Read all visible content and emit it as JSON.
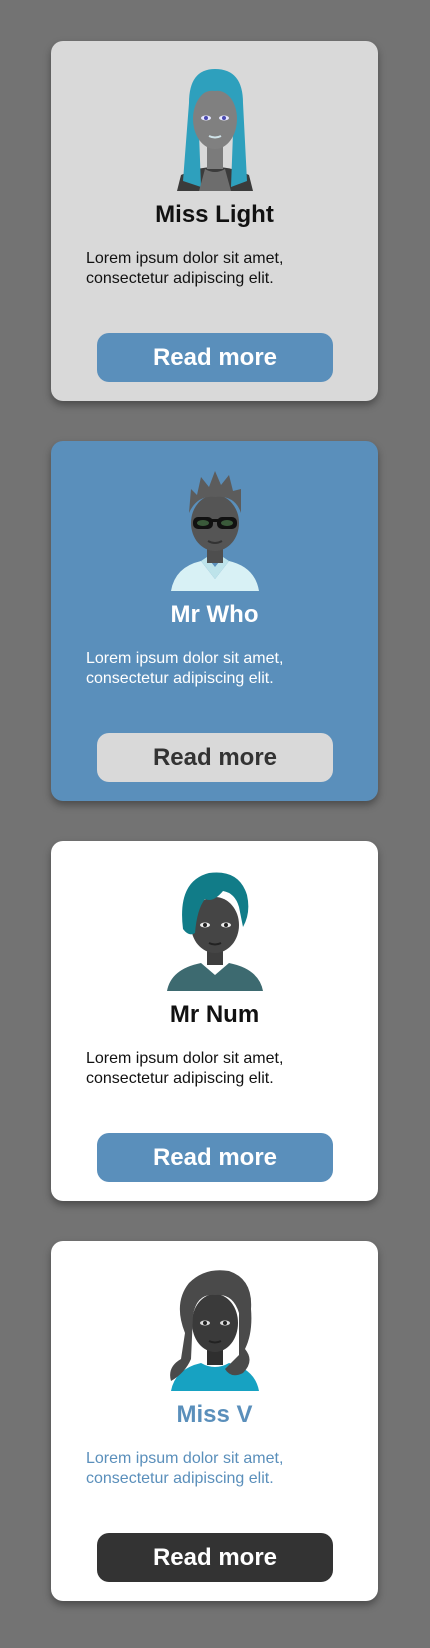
{
  "cards": [
    {
      "name": "Miss Light",
      "description": "Lorem ipsum dolor sit amet, consectetur adipiscing elit.",
      "button_label": "Read more",
      "avatar_icon": "female-avatar-long-teal-hair-icon"
    },
    {
      "name": "Mr Who",
      "description": "Lorem ipsum dolor sit amet, consectetur adipiscing elit.",
      "button_label": "Read more",
      "avatar_icon": "male-avatar-sunglasses-icon"
    },
    {
      "name": "Mr Num",
      "description": "Lorem ipsum dolor sit amet, consectetur adipiscing elit.",
      "button_label": "Read more",
      "avatar_icon": "male-avatar-teal-hair-icon"
    },
    {
      "name": "Miss V",
      "description": "Lorem ipsum dolor sit amet, consectetur adipiscing elit.",
      "button_label": "Read more",
      "avatar_icon": "female-avatar-wavy-hair-icon"
    }
  ],
  "colors": {
    "page_background": "#737373",
    "card_light_grey": "#d9d9d9",
    "card_blue": "#5a8fbb",
    "card_white": "#ffffff",
    "button_dark": "#333333"
  }
}
